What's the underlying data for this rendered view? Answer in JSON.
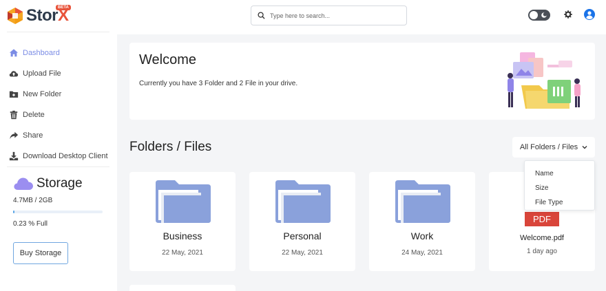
{
  "brand": {
    "name_main": "Stor",
    "name_accent": "X",
    "badge": "BETA"
  },
  "colors": {
    "accent": "#7b8ce5",
    "brand_red": "#e8533a",
    "folder_blue": "#8aa1db",
    "pdf_red": "#d9453a"
  },
  "sidebar": {
    "items": [
      {
        "label": "Dashboard",
        "icon": "home-icon"
      },
      {
        "label": "Upload File",
        "icon": "cloud-upload-icon"
      },
      {
        "label": "New Folder",
        "icon": "folder-plus-icon"
      },
      {
        "label": "Delete",
        "icon": "trash-icon"
      },
      {
        "label": "Share",
        "icon": "share-icon"
      },
      {
        "label": "Download Desktop Client",
        "icon": "download-icon"
      }
    ],
    "storage": {
      "title": "Storage",
      "amount": "4.7MB / 2GB",
      "percent_text": "0.23 % Full",
      "percent_value": 0.23
    },
    "buy_label": "Buy Storage"
  },
  "header": {
    "search_placeholder": "Type here to search..."
  },
  "welcome": {
    "title": "Welcome",
    "text": "Currently you have 3 Folder and 2 File in your drive."
  },
  "section": {
    "title": "Folders / Files",
    "filter_label": "All Folders / Files",
    "filter_options": [
      "Name",
      "Size",
      "File Type"
    ]
  },
  "items": [
    {
      "name": "Business",
      "date": "22 May, 2021",
      "type": "folder"
    },
    {
      "name": "Personal",
      "date": "22 May, 2021",
      "type": "folder"
    },
    {
      "name": "Work",
      "date": "24 May, 2021",
      "type": "folder"
    },
    {
      "name": "Welcome.pdf",
      "date": "1 day ago",
      "type": "pdf",
      "badge": "PDF"
    }
  ]
}
